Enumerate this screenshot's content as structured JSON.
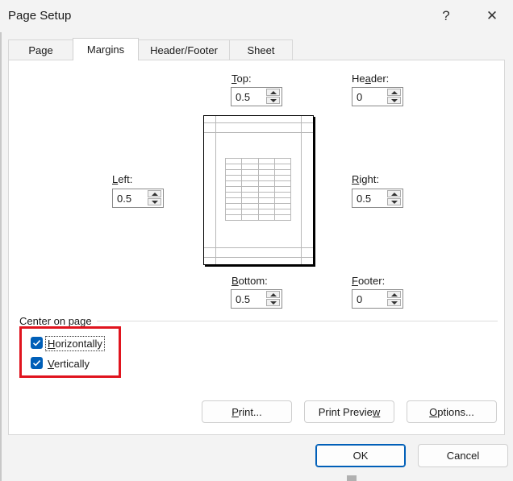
{
  "window": {
    "title": "Page Setup",
    "help_glyph": "?",
    "close_glyph": "✕"
  },
  "tabs": [
    {
      "label": "Page",
      "active": false
    },
    {
      "label": "Margins",
      "active": true
    },
    {
      "label": "Header/Footer",
      "active": false
    },
    {
      "label": "Sheet",
      "active": false
    }
  ],
  "margins": {
    "top": {
      "label_pre": "",
      "label_key": "T",
      "label_post": "op:",
      "value": "0.5"
    },
    "header": {
      "label_pre": "He",
      "label_key": "a",
      "label_post": "der:",
      "value": "0"
    },
    "left": {
      "label_pre": "",
      "label_key": "L",
      "label_post": "eft:",
      "value": "0.5"
    },
    "right": {
      "label_pre": "",
      "label_key": "R",
      "label_post": "ight:",
      "value": "0.5"
    },
    "bottom": {
      "label_pre": "",
      "label_key": "B",
      "label_post": "ottom:",
      "value": "0.5"
    },
    "footer": {
      "label_pre": "",
      "label_key": "F",
      "label_post": "ooter:",
      "value": "0"
    }
  },
  "center_on_page": {
    "label": "Center on page",
    "horizontally": {
      "label_pre": "",
      "label_key": "H",
      "label_post": "orizontally",
      "checked": true
    },
    "vertically": {
      "label_pre": "",
      "label_key": "V",
      "label_post": "ertically",
      "checked": true
    }
  },
  "buttons": {
    "print": {
      "label_pre": "",
      "label_key": "P",
      "label_post": "rint..."
    },
    "print_preview": {
      "label_pre": "Print Previe",
      "label_key": "w",
      "label_post": ""
    },
    "options": {
      "label_pre": "",
      "label_key": "O",
      "label_post": "ptions..."
    },
    "ok": "OK",
    "cancel": "Cancel"
  },
  "colors": {
    "accent": "#005fb8",
    "highlight": "#e0141e"
  },
  "icons": {
    "help": "help-icon",
    "close": "close-icon",
    "checkmark": "checkmark-icon",
    "spin_up": "chevron-up-icon",
    "spin_down": "chevron-down-icon"
  }
}
